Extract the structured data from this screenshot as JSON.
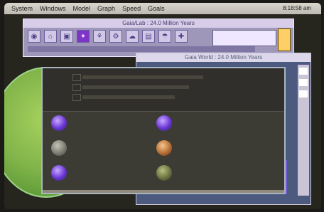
{
  "menubar": {
    "items": [
      "System",
      "Windows",
      "Model",
      "Graph",
      "Speed",
      "Goals"
    ],
    "clock": "8:18:58 am"
  },
  "toolbar_window": {
    "title": "Gaia/Lab : 24.0 Million Years"
  },
  "world_window": {
    "title": "Gaia World : 24.0 Million Years"
  },
  "dialog": {
    "entries": [
      {
        "label_line1": "",
        "label_line2": "",
        "icon": "purple-orb-icon"
      },
      {
        "label_line1": "",
        "label_line2": "",
        "icon": "purple-orb-icon"
      },
      {
        "label_line1": "",
        "label_line2": "",
        "icon": "gray-orb-icon"
      },
      {
        "label_line1": "",
        "label_line2": "",
        "icon": "orange-orb-icon"
      },
      {
        "label_line1": "",
        "label_line2": "",
        "icon": "purple-orb-icon"
      },
      {
        "label_line1": "",
        "label_line2": "",
        "icon": "olive-orb-icon"
      }
    ]
  },
  "colors": {
    "accent_purple": "#6b3fd8",
    "toolbar_bg": "#9e97b9",
    "world_bg": "#4d5a7f",
    "green_disk": "#7fb349"
  }
}
